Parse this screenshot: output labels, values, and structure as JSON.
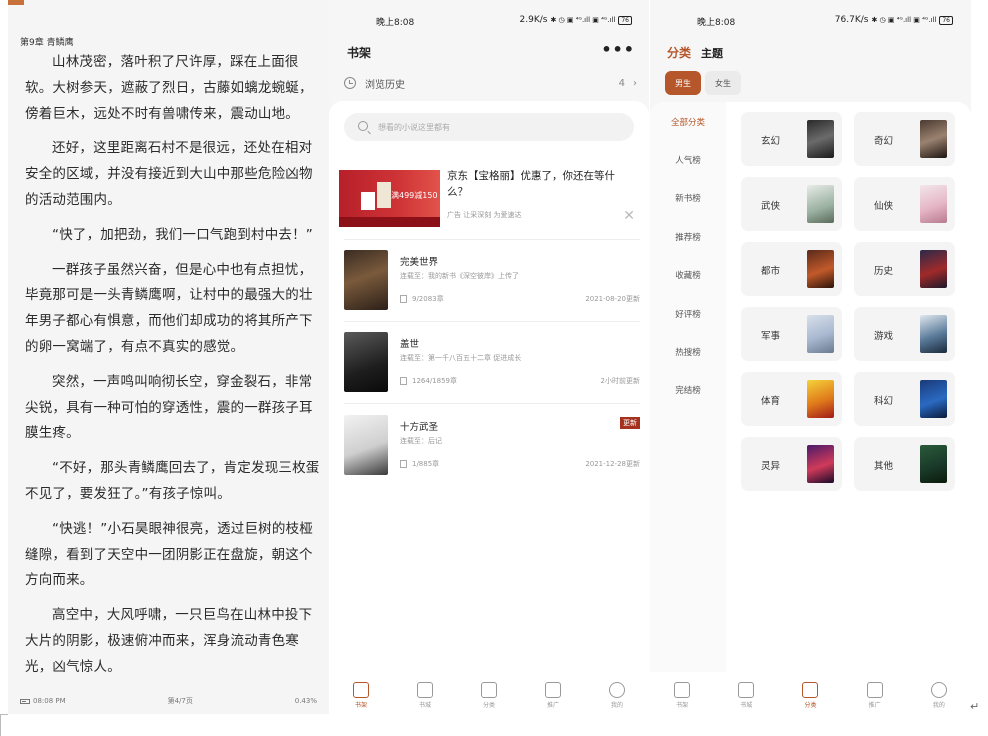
{
  "reader": {
    "chapter": "第9章 青鳞鹰",
    "paragraphs": [
      "山林茂密，落叶积了尺许厚，踩在上面很软。大树参天，遮蔽了烈日，古藤如螭龙蜿蜒，傍着巨木，远处不时有兽啸传来，震动山地。",
      "还好，这里距离石村不是很远，还处在相对安全的区域，并没有接近到大山中那些危险凶物的活动范围内。",
      "“快了，加把劲，我们一口气跑到村中去！”",
      "一群孩子虽然兴奋，但是心中也有点担忧，毕竟那可是一头青鳞鹰啊，让村中的最强大的壮年男子都心有惧意，而他们却成功的将其所产下的卵一窝端了，有点不真实的感觉。",
      "突然，一声鸣叫响彻长空，穿金裂石，非常尖锐，具有一种可怕的穿透性，震的一群孩子耳膜生疼。",
      "“不好，那头青鳞鹰回去了，肯定发现三枚蛋不见了，要发狂了。”有孩子惊叫。",
      "“快逃！”小石昊眼神很亮，透过巨树的枝桠缝隙，看到了天空中一团阴影正在盘旋，朝这个方向而来。",
      "高空中，大风呼啸，一只巨鸟在山林中投下大片的阴影，极速俯冲而来，浑身流动青色寒光，凶气惊人。"
    ],
    "footer_time": "08:08 PM",
    "footer_page": "第4/7页",
    "footer_percent": "0.43%"
  },
  "status_shelf": {
    "time": "晚上8:08",
    "net": "2.9K/s",
    "icons": "✱ ◷ ▣ ⁴ᴳ.ıll ▣ ⁴ᴳ.ıll",
    "battery": "76"
  },
  "status_cats": {
    "time": "晚上8:08",
    "net": "76.7K/s",
    "icons": "✱ ◷ ▣ ⁴ᴳ.ıll ▣ ⁴ᴳ.ıll",
    "battery": "76"
  },
  "shelf": {
    "title": "书架",
    "more": "•••",
    "history_label": "浏览历史",
    "history_count": "4",
    "history_chevron": "›",
    "search_placeholder": "想看的小说这里都有",
    "ad": {
      "promo": "满499减150",
      "text": "京东【宝格丽】优惠了，你还在等什么？",
      "meta": "广告  让采深刻 为爱速达",
      "close": "✕"
    },
    "books": [
      {
        "name": "完美世界",
        "update": "连载至：我的新书《深空彼岸》上传了",
        "progress": "9/2083章",
        "date": "2021-08-20更新",
        "badge": ""
      },
      {
        "name": "盖世",
        "update": "连载至：第一千八百五十二章 促进成长",
        "progress": "1264/1859章",
        "date": "2小时前更新",
        "badge": ""
      },
      {
        "name": "十方武圣",
        "update": "连载至：后记",
        "progress": "1/885章",
        "date": "2021-12-28更新",
        "badge": "更新"
      }
    ]
  },
  "tabs": [
    {
      "label": "书架"
    },
    {
      "label": "书城"
    },
    {
      "label": "分类"
    },
    {
      "label": "推广"
    },
    {
      "label": "我的"
    }
  ],
  "cats": {
    "tab_active": "分类",
    "tab_other": "主题",
    "male": "男生",
    "female": "女生",
    "side": [
      "全部分类",
      "人气榜",
      "新书榜",
      "推荐榜",
      "收藏榜",
      "好评榜",
      "热搜榜",
      "完结榜"
    ],
    "tiles": [
      "玄幻",
      "奇幻",
      "武侠",
      "仙侠",
      "都市",
      "历史",
      "军事",
      "游戏",
      "体育",
      "科幻",
      "灵异",
      "其他"
    ]
  },
  "colors": {
    "accent": "#b5572a"
  }
}
